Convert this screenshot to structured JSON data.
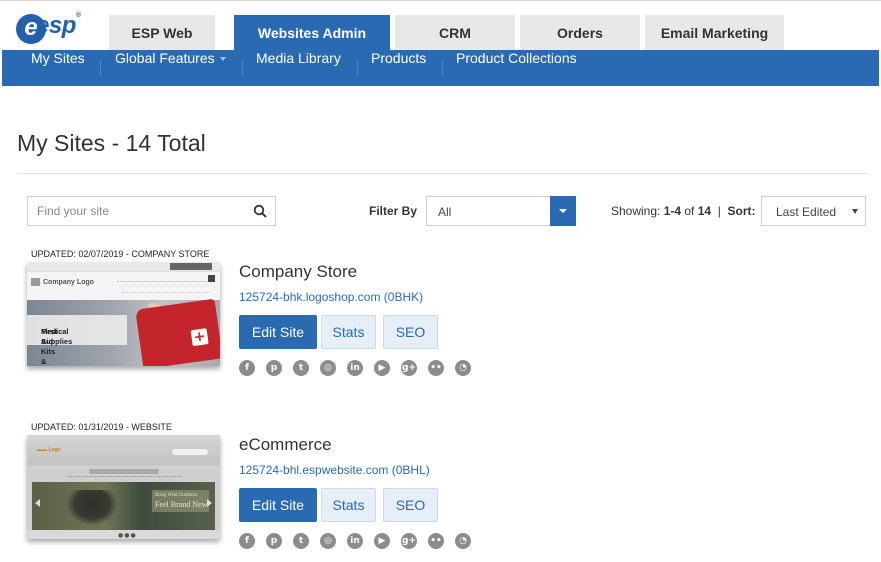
{
  "header": {
    "logo_text": "esp",
    "tabs": [
      {
        "label": "ESP Web",
        "active": false
      },
      {
        "label": "Websites Admin",
        "active": true
      },
      {
        "label": "CRM",
        "active": false
      },
      {
        "label": "Orders",
        "active": false
      },
      {
        "label": "Email Marketing",
        "active": false
      }
    ]
  },
  "subnav": {
    "items": [
      {
        "label": "My Sites"
      },
      {
        "label": "Global Features"
      },
      {
        "label": "Media Library"
      },
      {
        "label": "Products"
      },
      {
        "label": "Product Collections"
      }
    ]
  },
  "page": {
    "title": "My Sites - 14 Total"
  },
  "toolbar": {
    "search_placeholder": "Find your site",
    "filter_label": "Filter By",
    "filter_value": "All",
    "showing_prefix": "Showing: ",
    "showing_range": "1-4",
    "showing_of": " of ",
    "showing_total": "14",
    "showing_sep": "  |  ",
    "sort_label": "Sort:",
    "sort_value": "Last Edited"
  },
  "sites": [
    {
      "updated": "UPDATED: 02/07/2019 - COMPANY STORE",
      "name": "Company Store",
      "url": "125724-bhk.logoshop.com (0BHK)",
      "thumb_logo": "Company Logo",
      "thumb_caption_1": "First Aid Kits &",
      "thumb_caption_2": "Medical Supplies",
      "edit_label": "Edit Site",
      "stats_label": "Stats",
      "seo_label": "SEO"
    },
    {
      "updated": "UPDATED: 01/31/2019 - WEBSITE",
      "name": "eCommerce",
      "url": "125724-bhl.espwebsite.com (0BHL)",
      "thumb_small": "Bring Wild Outdoors",
      "thumb_big": "Feel Brand New",
      "edit_label": "Edit Site",
      "stats_label": "Stats",
      "seo_label": "SEO"
    }
  ],
  "social_icons": [
    {
      "name": "facebook-icon",
      "glyph": "f"
    },
    {
      "name": "pinterest-icon",
      "glyph": "p"
    },
    {
      "name": "twitter-icon",
      "glyph": "t"
    },
    {
      "name": "instagram-icon",
      "glyph": "◎"
    },
    {
      "name": "linkedin-icon",
      "glyph": "in"
    },
    {
      "name": "youtube-icon",
      "glyph": "▶"
    },
    {
      "name": "googleplus-icon",
      "glyph": "g+"
    },
    {
      "name": "flickr-icon",
      "glyph": "••"
    },
    {
      "name": "rss-icon",
      "glyph": "◔"
    }
  ],
  "colors": {
    "brand_blue": "#2a6ab3",
    "tab_inactive": "#e8e8e8",
    "link": "#2a6ab3",
    "social_grey": "#8c8c8c"
  }
}
